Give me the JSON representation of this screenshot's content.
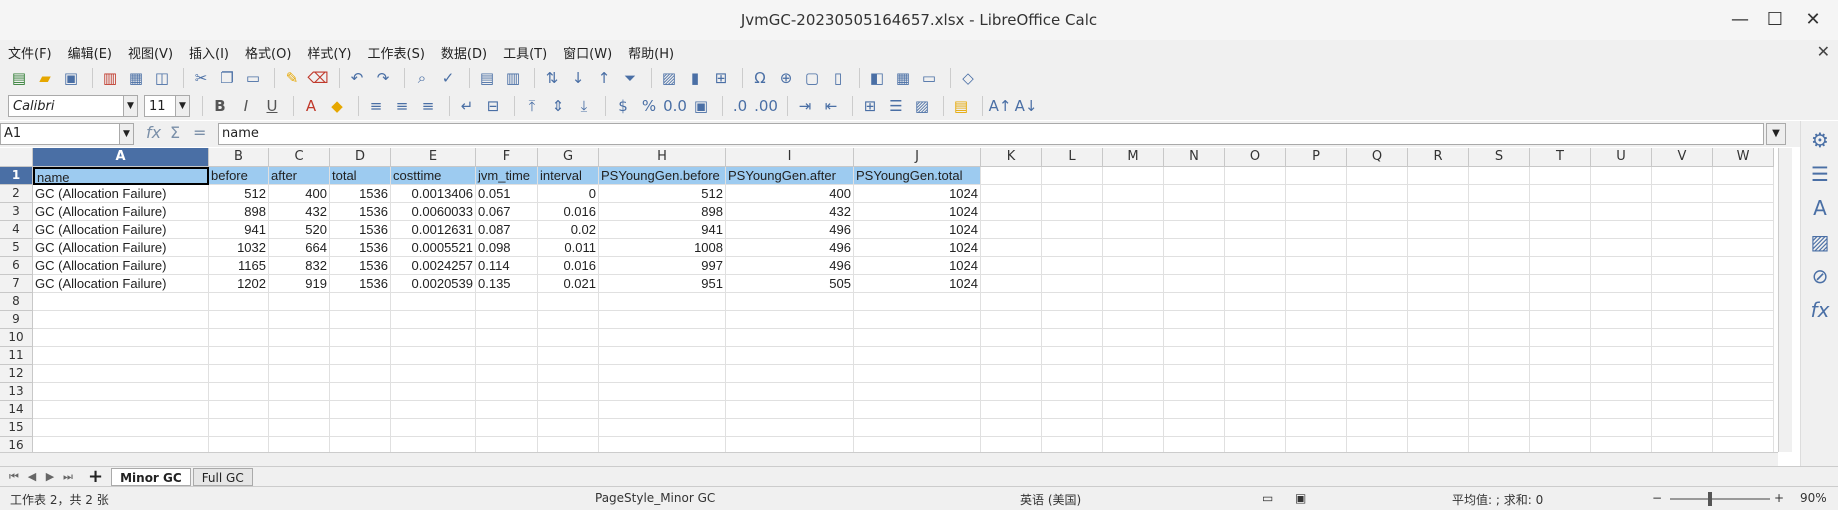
{
  "window": {
    "title": "JvmGC-20230505164657.xlsx - LibreOffice Calc",
    "controls": [
      "—",
      "☐",
      "✕"
    ]
  },
  "menu": {
    "items": [
      "文件(F)",
      "编辑(E)",
      "视图(V)",
      "插入(I)",
      "格式(O)",
      "样式(Y)",
      "工作表(S)",
      "数据(D)",
      "工具(T)",
      "窗口(W)",
      "帮助(H)"
    ],
    "close": "✕"
  },
  "format_toolbar": {
    "font_name": "Calibri",
    "font_size": "11"
  },
  "formula_bar": {
    "name_box": "A1",
    "content": "name"
  },
  "sheet": {
    "columns": [
      "A",
      "B",
      "C",
      "D",
      "E",
      "F",
      "G",
      "H",
      "I",
      "J",
      "K",
      "L",
      "M",
      "N",
      "O",
      "P",
      "Q",
      "R",
      "S",
      "T",
      "U",
      "V",
      "W"
    ],
    "row_numbers": [
      "1",
      "2",
      "3",
      "4",
      "5",
      "6",
      "7",
      "8",
      "9",
      "10",
      "11",
      "12",
      "13",
      "14",
      "15",
      "16"
    ],
    "header_row": [
      "name",
      "before",
      "after",
      "total",
      "costtime",
      "jvm_time",
      "interval",
      "PSYoungGen.before",
      "PSYoungGen.after",
      "PSYoungGen.total"
    ],
    "rows": [
      [
        "GC (Allocation Failure)",
        "512",
        "400",
        "1536",
        "0.0013406",
        "0.051",
        "0",
        "512",
        "400",
        "1024"
      ],
      [
        "GC (Allocation Failure)",
        "898",
        "432",
        "1536",
        "0.0060033",
        "0.067",
        "0.016",
        "898",
        "432",
        "1024"
      ],
      [
        "GC (Allocation Failure)",
        "941",
        "520",
        "1536",
        "0.0012631",
        "0.087",
        "0.02",
        "941",
        "496",
        "1024"
      ],
      [
        "GC (Allocation Failure)",
        "1032",
        "664",
        "1536",
        "0.0005521",
        "0.098",
        "0.011",
        "1008",
        "496",
        "1024"
      ],
      [
        "GC (Allocation Failure)",
        "1165",
        "832",
        "1536",
        "0.0024257",
        "0.114",
        "0.016",
        "997",
        "496",
        "1024"
      ],
      [
        "GC (Allocation Failure)",
        "1202",
        "919",
        "1536",
        "0.0020539",
        "0.135",
        "0.021",
        "951",
        "505",
        "1024"
      ]
    ]
  },
  "tabs": {
    "add": "+",
    "items": [
      "Minor GC",
      "Full GC"
    ],
    "active": "Minor GC"
  },
  "status": {
    "sheet_info": "工作表 2，共 2 张",
    "page_style": "PageStyle_Minor GC",
    "language": "英语 (美国)",
    "aggregate": "平均值: ; 求和: 0",
    "zoom": "90%"
  },
  "colors": {
    "header_fill": "#9dcbf0",
    "selection": "#4a6fa5"
  }
}
